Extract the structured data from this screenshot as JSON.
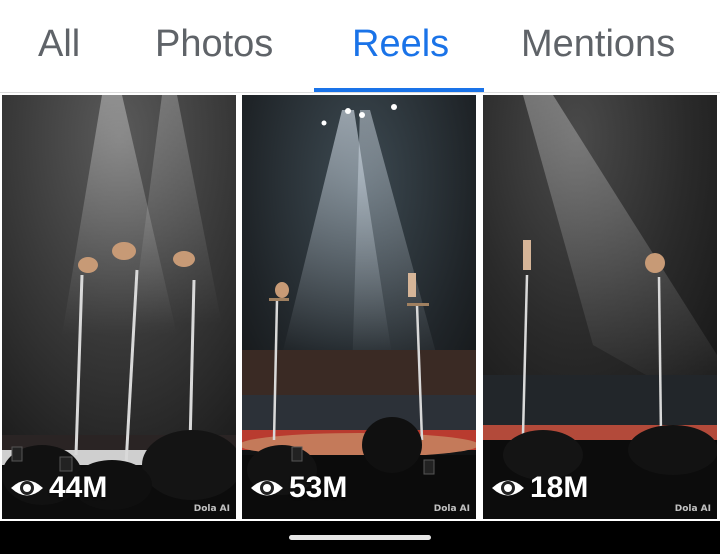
{
  "tabs": [
    {
      "label": "All",
      "active": false
    },
    {
      "label": "Photos",
      "active": false
    },
    {
      "label": "Reels",
      "active": true
    },
    {
      "label": "Mentions",
      "active": false
    }
  ],
  "accent_color": "#1a73e8",
  "reels": [
    {
      "views": "44M",
      "watermark": "Dola AI",
      "icon": "eye-icon"
    },
    {
      "views": "53M",
      "watermark": "Dola AI",
      "icon": "eye-icon"
    },
    {
      "views": "18M",
      "watermark": "Dola AI",
      "icon": "eye-icon"
    }
  ]
}
